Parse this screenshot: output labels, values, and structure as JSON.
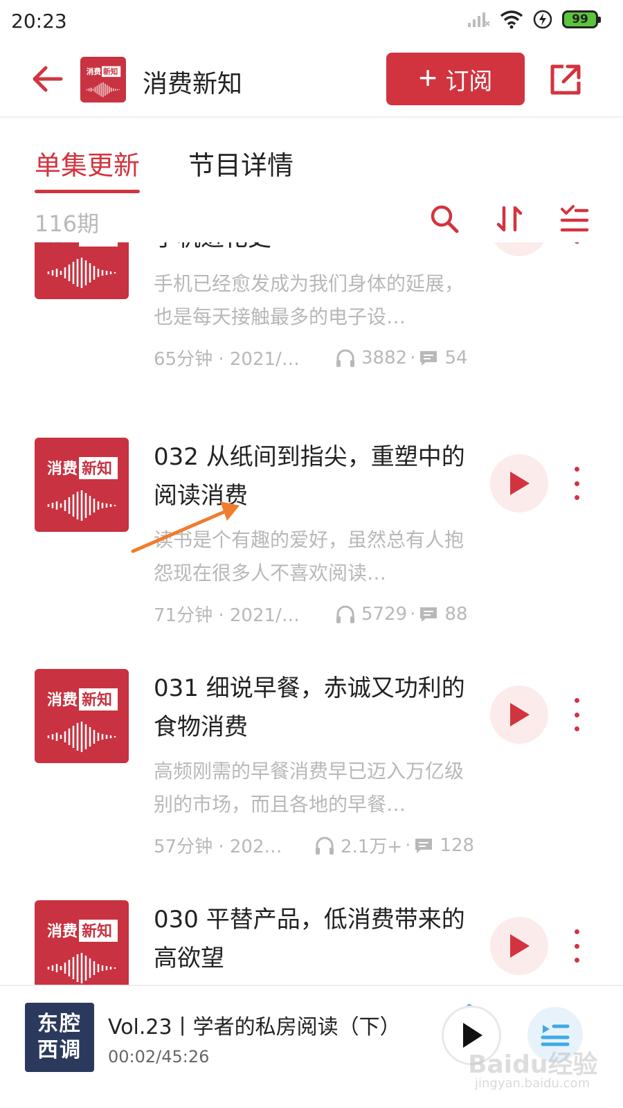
{
  "status_bar": {
    "time": "20:23",
    "battery": "99",
    "icons": [
      "signal-icon",
      "wifi-icon",
      "charging-icon",
      "battery-icon"
    ]
  },
  "header": {
    "title": "消费新知",
    "subscribe_label": "订阅",
    "subscribe_plus": "+"
  },
  "tabs": [
    {
      "label": "单集更新",
      "active": true
    },
    {
      "label": "节目详情",
      "active": false
    }
  ],
  "toolbar": {
    "count": "116期",
    "icons": [
      "search-icon",
      "sort-icon",
      "batch-select-icon"
    ]
  },
  "cover": {
    "line1_a": "消费",
    "line1_b": "新知"
  },
  "episodes": [
    {
      "title": "手机进化史",
      "description": "手机已经愈发成为我们身体的延展，也是每天接触最多的电子设…",
      "duration_date": "65分钟 · 2021/0…",
      "listens": "3882",
      "comments": "54"
    },
    {
      "title": "032 从纸间到指尖，重塑中的阅读消费",
      "description": "读书是个有趣的爱好，虽然总有人抱怨现在很多人不喜欢阅读…",
      "duration_date": "71分钟 · 2021/0…",
      "listens": "5729",
      "comments": "88"
    },
    {
      "title": "031 细说早餐，赤诚又功利的食物消费",
      "description": "高频刚需的早餐消费早已迈入万亿级别的市场，而且各地的早餐…",
      "duration_date": "57分钟 · 2021…",
      "listens": "2.1万+",
      "comments": "128"
    },
    {
      "title": "030 平替产品，低消费带来的高欲望",
      "description": "",
      "duration_date": "",
      "listens": "",
      "comments": ""
    }
  ],
  "mini_player": {
    "cover_line1": "东腔",
    "cover_line2": "西调",
    "title": "Vol.23丨学者的私房阅读（下）",
    "time": "00:02/45:26"
  },
  "watermark": {
    "text": "Baidu经验",
    "sub": "jingyan.baidu.com"
  },
  "colors": {
    "accent": "#d2343f",
    "play_bg": "#fbeceb",
    "muted_text": "#b8b8b8",
    "annotation": "#f07c2e"
  }
}
